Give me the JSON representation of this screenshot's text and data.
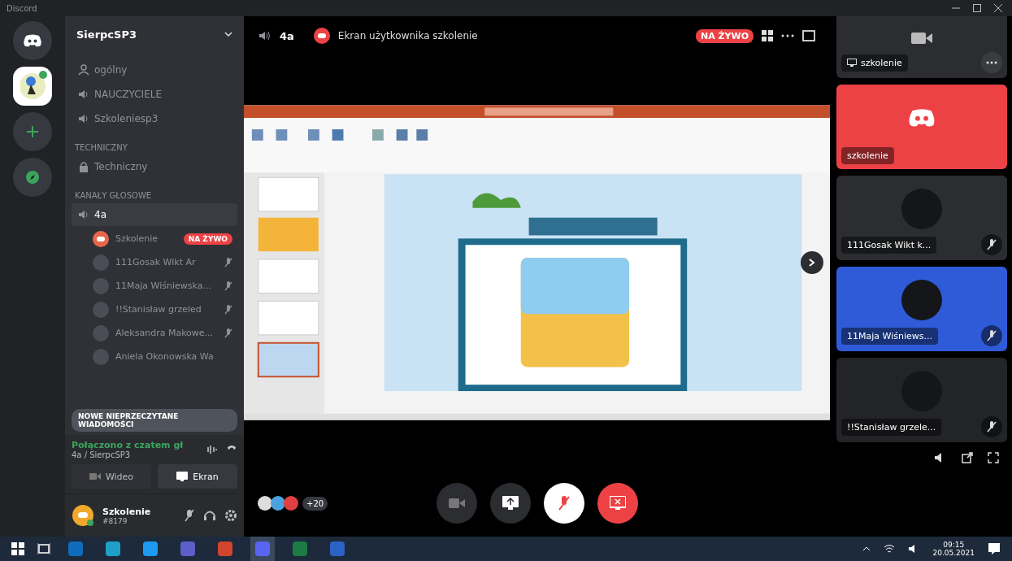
{
  "window": {
    "title": "Discord"
  },
  "servers": [
    {
      "kind": "home",
      "selected": false
    },
    {
      "kind": "server",
      "selected": true
    },
    {
      "kind": "add",
      "selected": false
    },
    {
      "kind": "explore",
      "selected": false
    }
  ],
  "sidebar": {
    "server_name": "SierpcSP3",
    "channels": [
      {
        "kind": "stage",
        "name": "ogólny",
        "selected": false
      },
      {
        "kind": "voice",
        "name": "NAUCZYCIELE",
        "selected": false
      },
      {
        "kind": "voice",
        "name": "Szkoleniesp3",
        "selected": false
      }
    ],
    "categories": [
      {
        "name": "TECHNICZNY",
        "channels": [
          {
            "kind": "locked",
            "name": "Techniczny",
            "selected": false
          }
        ]
      },
      {
        "name": "KANAŁY GŁOSOWE",
        "channels": [
          {
            "kind": "voice",
            "name": "4a",
            "selected": true,
            "members": [
              {
                "kind": "streamer",
                "name": "Szkolenie",
                "live": "NA ŻYWO",
                "muted": false
              },
              {
                "kind": "member",
                "name": "111Gosak Wikt Ar",
                "muted": true
              },
              {
                "kind": "member",
                "name": "11Maja Wiśniewska...",
                "muted": true
              },
              {
                "kind": "member",
                "name": "!!Stanisław grzeled",
                "muted": true
              },
              {
                "kind": "member",
                "name": "Aleksandra Makowe...",
                "muted": true
              },
              {
                "kind": "member",
                "name": "Aniela Okonowska Wa",
                "muted": false
              }
            ]
          }
        ]
      }
    ],
    "unread_banner": "NOWE NIEPRZECZYTANE WIADOMOŚCI",
    "voice_panel": {
      "status": "Połączono z czatem gł",
      "channel": "4a / SierpcSP3",
      "buttons": [
        {
          "kind": "video",
          "label": "Wideo"
        },
        {
          "kind": "screen",
          "label": "Ekran"
        }
      ]
    },
    "user": {
      "name": "Szkolenie",
      "tag": "#8179"
    }
  },
  "header": {
    "channel": "4a",
    "stream_title": "Ekran użytkownika szkolenie",
    "live": "NA ŻYWO"
  },
  "call_bar": {
    "extra_count": "+20",
    "controls": [
      {
        "kind": "camera"
      },
      {
        "kind": "screen"
      },
      {
        "kind": "mic"
      },
      {
        "kind": "stop"
      }
    ]
  },
  "participants": [
    {
      "kind": "stream",
      "name": "szkolenie",
      "color": "#2b2d31",
      "muted": false
    },
    {
      "kind": "avatar",
      "name": "szkolenie",
      "color": "#ed4245",
      "muted": false
    },
    {
      "kind": "avatar",
      "name": "111Gosak Wikt k...",
      "color": "#2b2d31",
      "muted": true
    },
    {
      "kind": "avatar",
      "name": "11Maja Wiśniews...",
      "color": "#2f5bd8",
      "muted": true
    },
    {
      "kind": "avatar",
      "name": "!!Stanisław grzele...",
      "color": "#232428",
      "muted": true
    }
  ],
  "taskbar": {
    "apps": [
      {
        "kind": "outlook",
        "active": false
      },
      {
        "kind": "edge",
        "active": false
      },
      {
        "kind": "skype",
        "active": false
      },
      {
        "kind": "teams",
        "active": false
      },
      {
        "kind": "powerpoint",
        "active": false
      },
      {
        "kind": "discord",
        "active": true
      },
      {
        "kind": "excel",
        "active": false
      },
      {
        "kind": "word",
        "active": false
      }
    ],
    "time": "09:15",
    "date": "20.05.2021"
  }
}
